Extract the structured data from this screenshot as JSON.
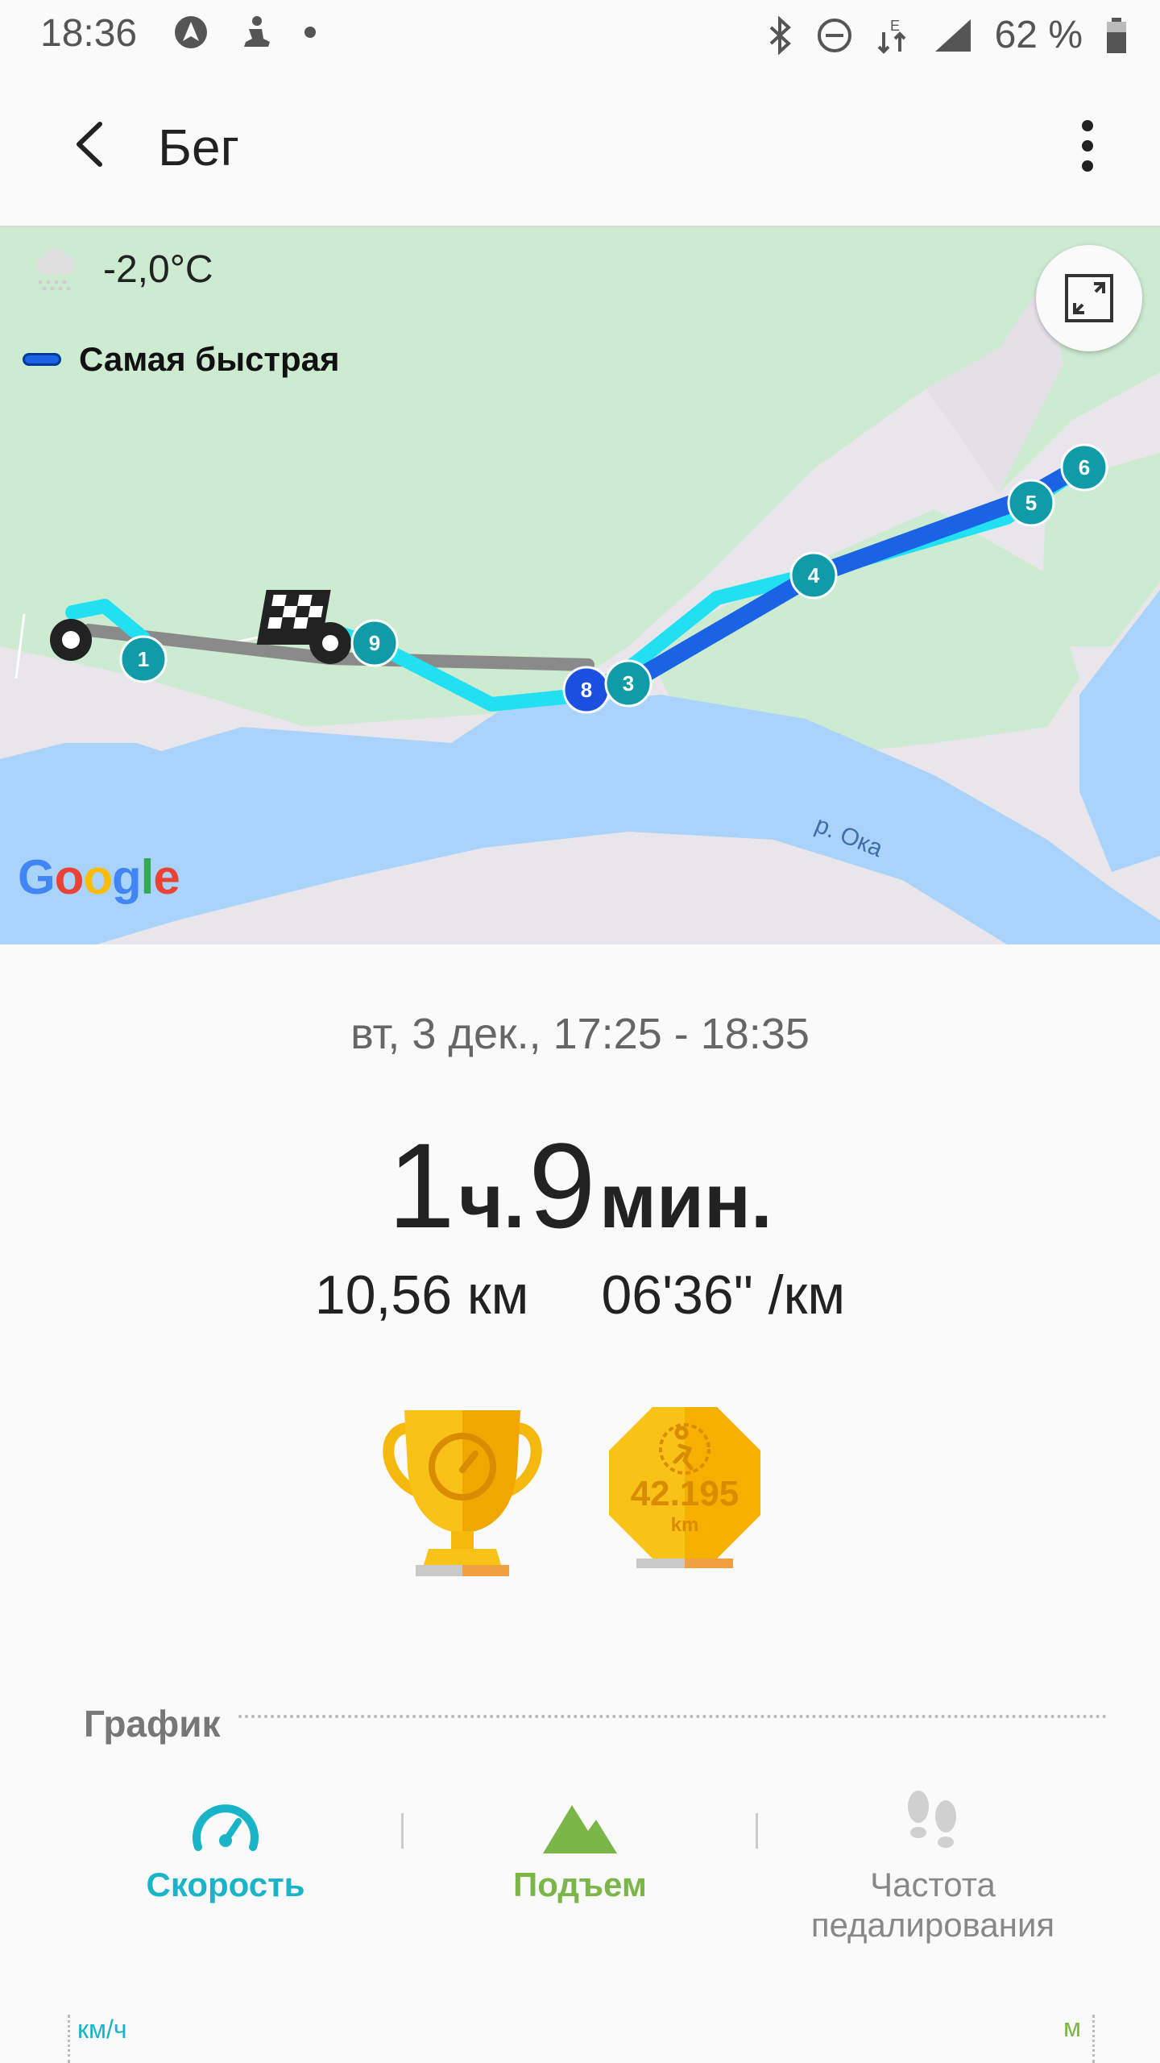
{
  "status_bar": {
    "time": "18:36",
    "battery": "62 %",
    "left_icons": [
      "navigation-icon",
      "yoga-icon",
      "dot-icon"
    ],
    "right_icons": [
      "bluetooth-icon",
      "do-not-disturb-icon",
      "data-e-icon",
      "signal-icon",
      "battery-icon"
    ]
  },
  "app_bar": {
    "title": "Бег",
    "back_icon": "back-arrow-icon",
    "more_icon": "more-vert-icon"
  },
  "map": {
    "temperature": "-2,0°C",
    "weather_icon": "cloud-snow-icon",
    "legend_label": "Самая быстрая",
    "legend_color": "#1a63e5",
    "river_label": "р. Ока",
    "google_logo": "Google",
    "markers": [
      "1",
      "3",
      "4",
      "5",
      "6",
      "8",
      "9"
    ]
  },
  "summary": {
    "date_range": "вт, 3 дек., 17:25 - 18:35",
    "hours": "1",
    "hours_unit": "ч.",
    "minutes": "9",
    "minutes_unit": "мин.",
    "distance": "10,56 км",
    "pace": "06'36\" /км"
  },
  "achievements": {
    "medal_value": "42.195",
    "medal_unit": "km"
  },
  "graph": {
    "section_title": "График",
    "tabs": [
      {
        "label": "Скорость",
        "color": "#19b4c8"
      },
      {
        "label": "Подъем",
        "color": "#7ab648"
      },
      {
        "label": "Частота педалирования",
        "color": "#888888"
      }
    ],
    "axis_left_unit": "км/ч",
    "axis_right_unit": "м"
  }
}
